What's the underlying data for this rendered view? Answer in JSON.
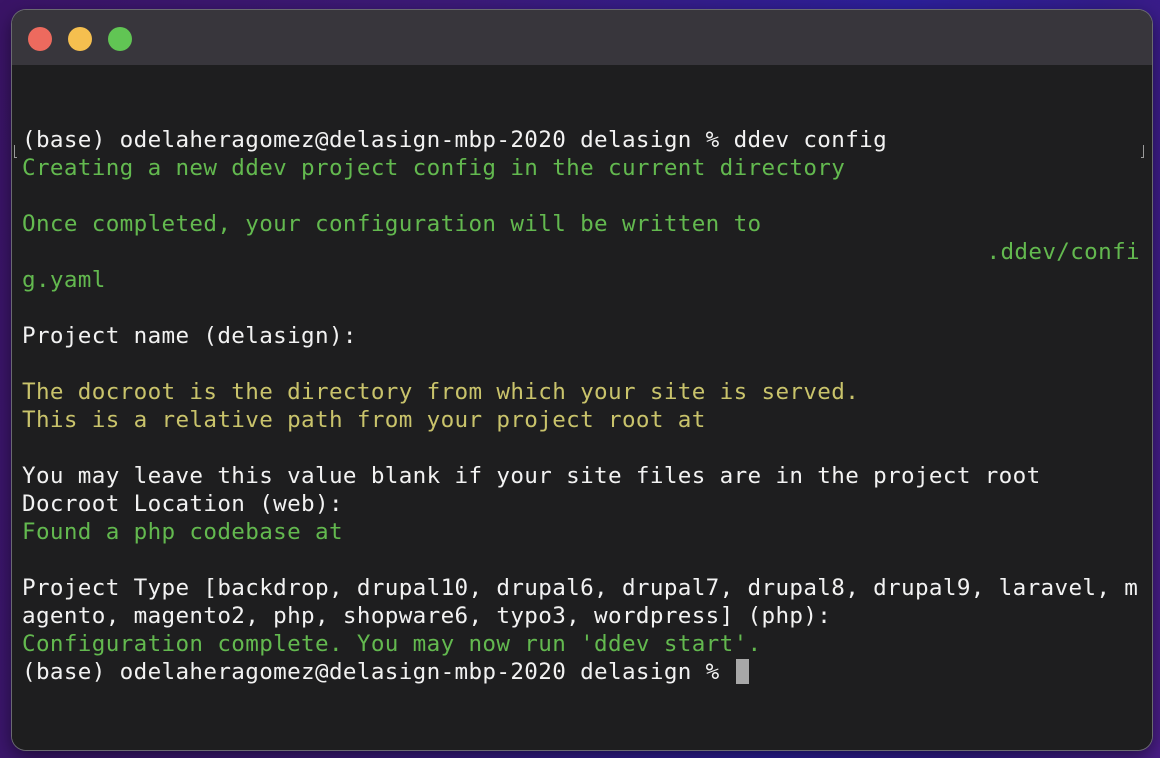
{
  "window": {
    "controls": {
      "close": "close-button",
      "minimize": "minimize-button",
      "maximize": "maximize-button"
    }
  },
  "terminal": {
    "lines": [
      {
        "text": "(base) odelaheragomez@delasign-mbp-2020 delasign % ddev config",
        "color": "white"
      },
      {
        "text": "Creating a new ddev project config in the current directory",
        "color": "green"
      },
      {
        "text": "",
        "color": "white"
      },
      {
        "text": "Once completed, your configuration will be written to",
        "color": "green"
      },
      {
        "text": ".ddev/confi",
        "color": "green",
        "align": "right"
      },
      {
        "text": "g.yaml",
        "color": "green"
      },
      {
        "text": "",
        "color": "white"
      },
      {
        "text": "Project name (delasign):",
        "color": "white"
      },
      {
        "text": "",
        "color": "white"
      },
      {
        "text": "The docroot is the directory from which your site is served.",
        "color": "yellow"
      },
      {
        "text": "This is a relative path from your project root at",
        "color": "yellow"
      },
      {
        "text": "",
        "color": "yellow"
      },
      {
        "text": "You may leave this value blank if your site files are in the project root",
        "color": "white"
      },
      {
        "text": "Docroot Location (web):",
        "color": "white"
      },
      {
        "text": "Found a php codebase at",
        "color": "green"
      },
      {
        "text": "",
        "color": "white"
      },
      {
        "text": "Project Type [backdrop, drupal10, drupal6, drupal7, drupal8, drupal9, laravel, m",
        "color": "white"
      },
      {
        "text": "agento, magento2, php, shopware6, typo3, wordpress] (php):",
        "color": "white"
      },
      {
        "text": "Configuration complete. You may now run 'ddev start'.",
        "color": "green"
      },
      {
        "text": "(base) odelaheragomez@delasign-mbp-2020 delasign % ",
        "color": "white",
        "cursor": true
      }
    ]
  },
  "colors": {
    "white": "#f2f2f2",
    "green": "#63b94f",
    "yellow": "#c9c36b",
    "background": "#1e1e1f",
    "titlebar": "#38363c",
    "close": "#ed6a5e",
    "minimize": "#f5bf4f",
    "maximize": "#61c554"
  }
}
